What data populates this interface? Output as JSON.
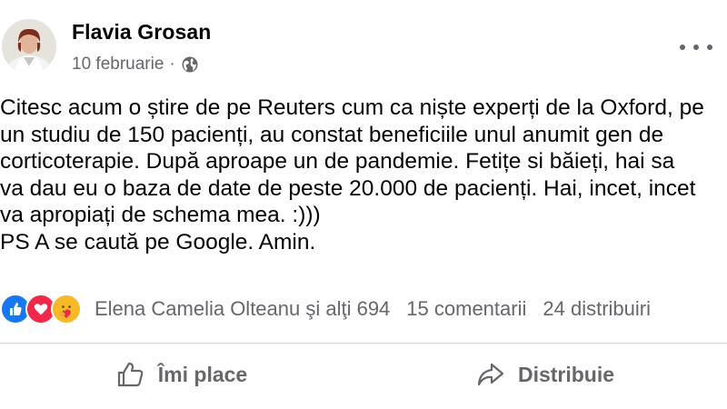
{
  "post": {
    "author": "Flavia Grosan",
    "date": "10 februarie",
    "date_separator": "·",
    "privacy_icon": "globe-icon",
    "text_lines": [
      "Citesc acum o știre de pe Reuters cum ca niște experți de la Oxford, pe",
      "un studiu de 150 pacienți, au constat beneficiile unul anumit gen de",
      "corticoterapie. După aproape un de pandemie. Fetițe si băieți, hai sa",
      "va dau eu o baza de date de peste 20.000 de pacienți. Hai, incet, incet",
      "va apropiați de schema mea. :)))",
      "PS A se caută pe Google. Amin."
    ]
  },
  "reactions": {
    "types": [
      "like",
      "love",
      "care"
    ],
    "reactors": "Elena Camelia Olteanu şi alţi 694",
    "comments": "15 comentarii",
    "shares": "24 distribuiri"
  },
  "actions": {
    "like_label": "Îmi place",
    "share_label": "Distribuie"
  },
  "colors": {
    "like_blue": "#1877f2",
    "love_red": "#f0284a",
    "care_yellow": "#f7b928",
    "secondary_text": "#65676b"
  }
}
